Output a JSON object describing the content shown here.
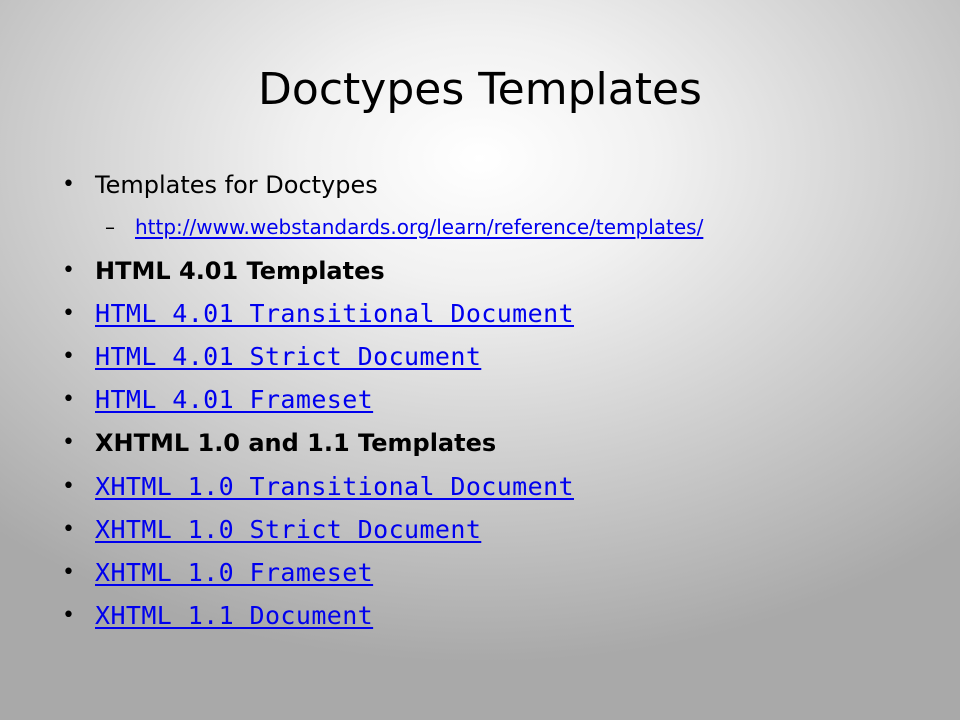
{
  "slide": {
    "title": "Doctypes Templates",
    "bullet_glyph": "•",
    "dash_glyph": "–",
    "items": [
      {
        "text": "Templates for Doctypes",
        "type": "plain"
      },
      {
        "text": "http://www.webstandards.org/learn/reference/templates/",
        "type": "sublink"
      },
      {
        "text": "HTML 4.01 Templates",
        "type": "bold"
      },
      {
        "text": "HTML 4.01 Transitional Document",
        "type": "link"
      },
      {
        "text": "HTML 4.01 Strict Document",
        "type": "link"
      },
      {
        "text": "HTML 4.01 Frameset",
        "type": "link"
      },
      {
        "text": "XHTML 1.0 and 1.1 Templates",
        "type": "bold"
      },
      {
        "text": "XHTML 1.0 Transitional Document",
        "type": "link"
      },
      {
        "text": "XHTML 1.0 Strict Document",
        "type": "link"
      },
      {
        "text": "XHTML 1.0 Frameset",
        "type": "link"
      },
      {
        "text": "XHTML 1.1 Document",
        "type": "link"
      }
    ]
  }
}
